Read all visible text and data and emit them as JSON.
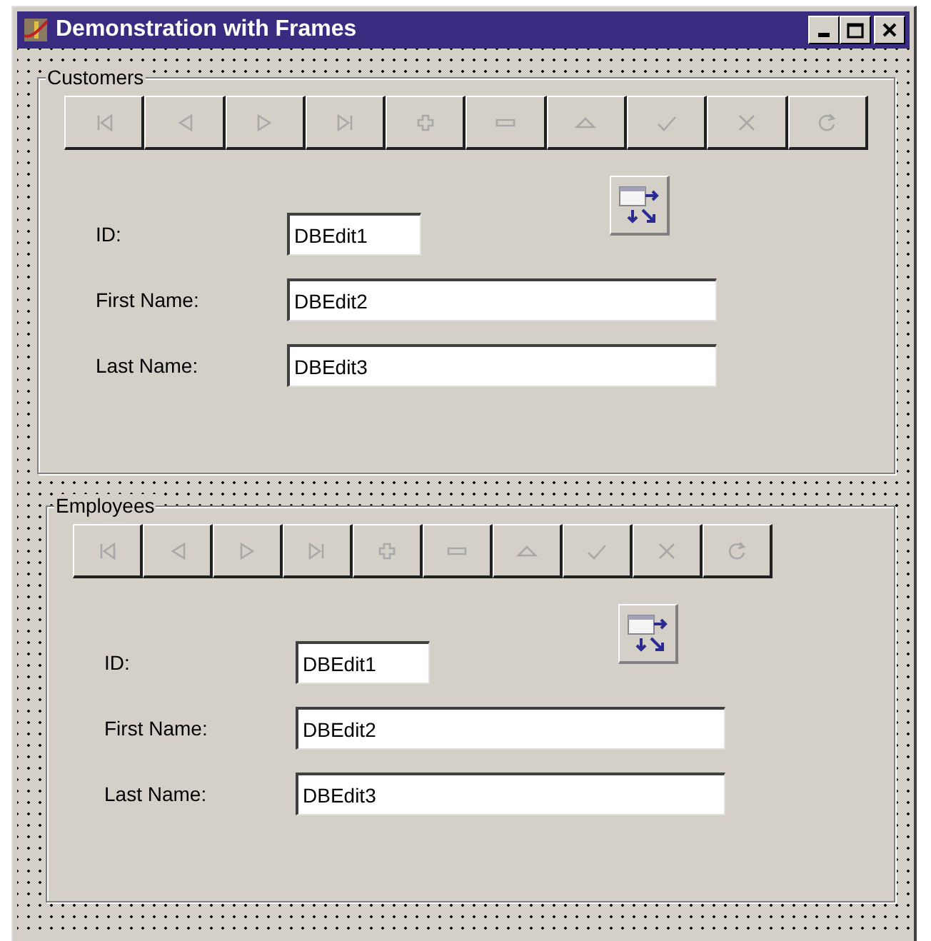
{
  "window": {
    "title": "Demonstration with Frames"
  },
  "frames": [
    {
      "title": "Customers",
      "navigator": [
        {
          "kind": "first",
          "disabled": true
        },
        {
          "kind": "prior",
          "disabled": true
        },
        {
          "kind": "next",
          "disabled": true
        },
        {
          "kind": "last",
          "disabled": true
        },
        {
          "kind": "insert",
          "disabled": true
        },
        {
          "kind": "delete",
          "disabled": true
        },
        {
          "kind": "edit",
          "disabled": true
        },
        {
          "kind": "post",
          "disabled": true
        },
        {
          "kind": "cancel",
          "disabled": true
        },
        {
          "kind": "refresh",
          "disabled": true
        }
      ],
      "fields": [
        {
          "label": "ID:",
          "value": "DBEdit1",
          "kind": "short"
        },
        {
          "label": "First Name:",
          "value": "DBEdit2",
          "kind": "long"
        },
        {
          "label": "Last Name:",
          "value": "DBEdit3",
          "kind": "long"
        }
      ]
    },
    {
      "title": "Employees",
      "navigator": [
        {
          "kind": "first",
          "disabled": true
        },
        {
          "kind": "prior",
          "disabled": true
        },
        {
          "kind": "next",
          "disabled": true
        },
        {
          "kind": "last",
          "disabled": true
        },
        {
          "kind": "insert",
          "disabled": true
        },
        {
          "kind": "delete",
          "disabled": true
        },
        {
          "kind": "edit",
          "disabled": true
        },
        {
          "kind": "post",
          "disabled": true
        },
        {
          "kind": "cancel",
          "disabled": true
        },
        {
          "kind": "refresh",
          "disabled": true
        }
      ],
      "fields": [
        {
          "label": "ID:",
          "value": "DBEdit1",
          "kind": "short"
        },
        {
          "label": "First Name:",
          "value": "DBEdit2",
          "kind": "long"
        },
        {
          "label": "Last Name:",
          "value": "DBEdit3",
          "kind": "long"
        }
      ]
    }
  ]
}
